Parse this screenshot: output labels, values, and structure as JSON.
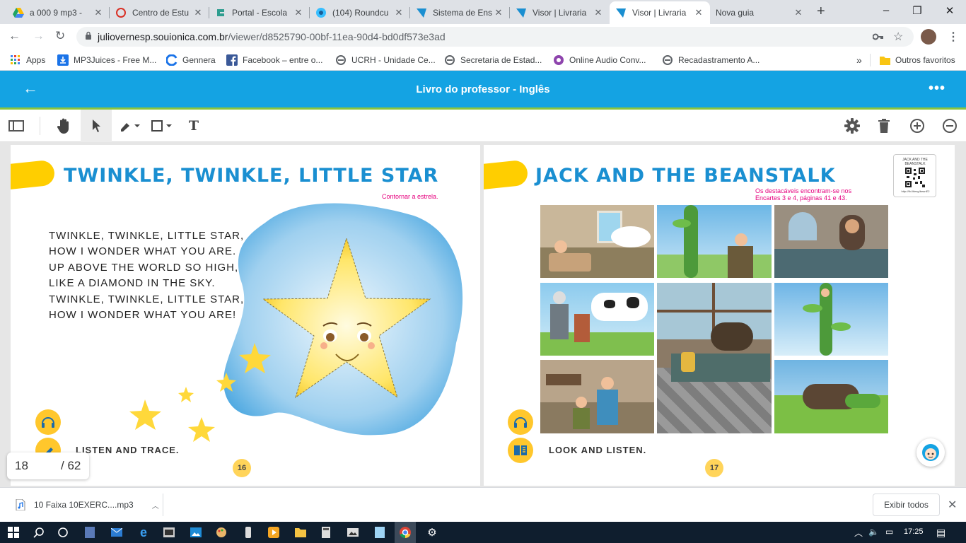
{
  "tabs": [
    {
      "title": "a 000 9 mp3 -",
      "icon": "google-drive-icon",
      "active": false
    },
    {
      "title": "Centro de Estu",
      "icon": "cebs-icon",
      "active": false
    },
    {
      "title": "Portal - Escola",
      "icon": "portal-icon",
      "active": false
    },
    {
      "title": "(104) Roundcu",
      "icon": "roundcube-icon",
      "active": false
    },
    {
      "title": "Sistema de Ens",
      "icon": "sistema-icon",
      "active": false
    },
    {
      "title": "Visor | Livraria",
      "icon": "visor-icon",
      "active": false
    },
    {
      "title": "Visor | Livraria",
      "icon": "visor-icon",
      "active": true
    },
    {
      "title": "Nova guia",
      "icon": "",
      "active": false
    }
  ],
  "address": {
    "host": "juliovernesp.souionica.com.br",
    "path": "/viewer/d8525790-00bf-11ea-90d4-bd0df573e3ad"
  },
  "bookmarks": [
    {
      "label": "Apps",
      "icon": "apps-grid-icon"
    },
    {
      "label": "MP3Juices - Free M...",
      "icon": "download-icon"
    },
    {
      "label": "Gennera",
      "icon": "gennera-icon"
    },
    {
      "label": "Facebook – entre o...",
      "icon": "facebook-icon"
    },
    {
      "label": "UCRH - Unidade Ce...",
      "icon": "globe-icon"
    },
    {
      "label": "Secretaria de Estad...",
      "icon": "globe-icon"
    },
    {
      "label": "Online Audio Conv...",
      "icon": "audio-converter-icon"
    },
    {
      "label": "Recadastramento A...",
      "icon": "globe-icon"
    }
  ],
  "bookmarks_more": "»",
  "bookmarks_other": "Outros favoritos",
  "app": {
    "title": "Livro do professor - Inglês"
  },
  "pages": {
    "left": {
      "title": "TWINKLE, TWINKLE, LITTLE STAR",
      "note": "Contornar a estrela.",
      "poem": [
        "TWINKLE, TWINKLE, LITTLE STAR,",
        "HOW I WONDER WHAT YOU ARE.",
        "UP ABOVE THE WORLD SO HIGH,",
        "LIKE A DIAMOND IN THE SKY.",
        "TWINKLE, TWINKLE, LITTLE STAR,",
        "HOW I WONDER WHAT YOU ARE!"
      ],
      "instruction": "LISTEN AND TRACE.",
      "number": "16"
    },
    "right": {
      "title": "JACK AND THE BEANSTALK",
      "note_line1": "Os destacáveis encontram-se nos",
      "note_line2": "Encartes 3 e 4, páginas 41 e 43.",
      "qr_caption": "JACK AND THE BEANSTALK",
      "qr_url": "http://fbi.lt/eng/beanE2",
      "instruction": "LOOK AND LISTEN.",
      "number": "17"
    }
  },
  "pager": {
    "current": "18",
    "total": "/ 62"
  },
  "download": {
    "file": "10 Faixa 10EXERC....mp3",
    "show_all": "Exibir todos"
  },
  "clock": "17:25",
  "colors": {
    "app_blue": "#14a3e3",
    "title_blue": "#1a8fd1",
    "accent_yellow": "#ffc72c",
    "green_strip": "#8bc53f"
  }
}
